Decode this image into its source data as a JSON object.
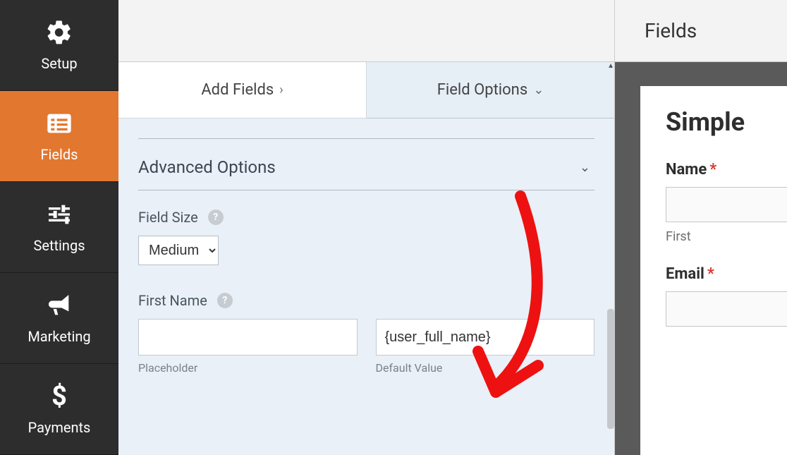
{
  "nav": {
    "items": [
      {
        "label": "Setup",
        "icon": "gear-icon"
      },
      {
        "label": "Fields",
        "icon": "list-icon"
      },
      {
        "label": "Settings",
        "icon": "sliders-icon"
      },
      {
        "label": "Marketing",
        "icon": "bullhorn-icon"
      },
      {
        "label": "Payments",
        "icon": "dollar-icon"
      }
    ],
    "active_index": 1
  },
  "tabs": {
    "add_fields": "Add Fields",
    "field_options": "Field Options"
  },
  "panel": {
    "section_title": "Advanced Options",
    "field_size_label": "Field Size",
    "field_size_value": "Medium",
    "first_name_label": "First Name",
    "placeholder_sub": "Placeholder",
    "default_value_sub": "Default Value",
    "first_name_placeholder_value": "",
    "first_name_default_value": "{user_full_name}"
  },
  "preview": {
    "header": "Fields",
    "form_title": "Simple",
    "name_label": "Name",
    "name_sub": "First",
    "email_label": "Email",
    "required_mark": "*"
  }
}
